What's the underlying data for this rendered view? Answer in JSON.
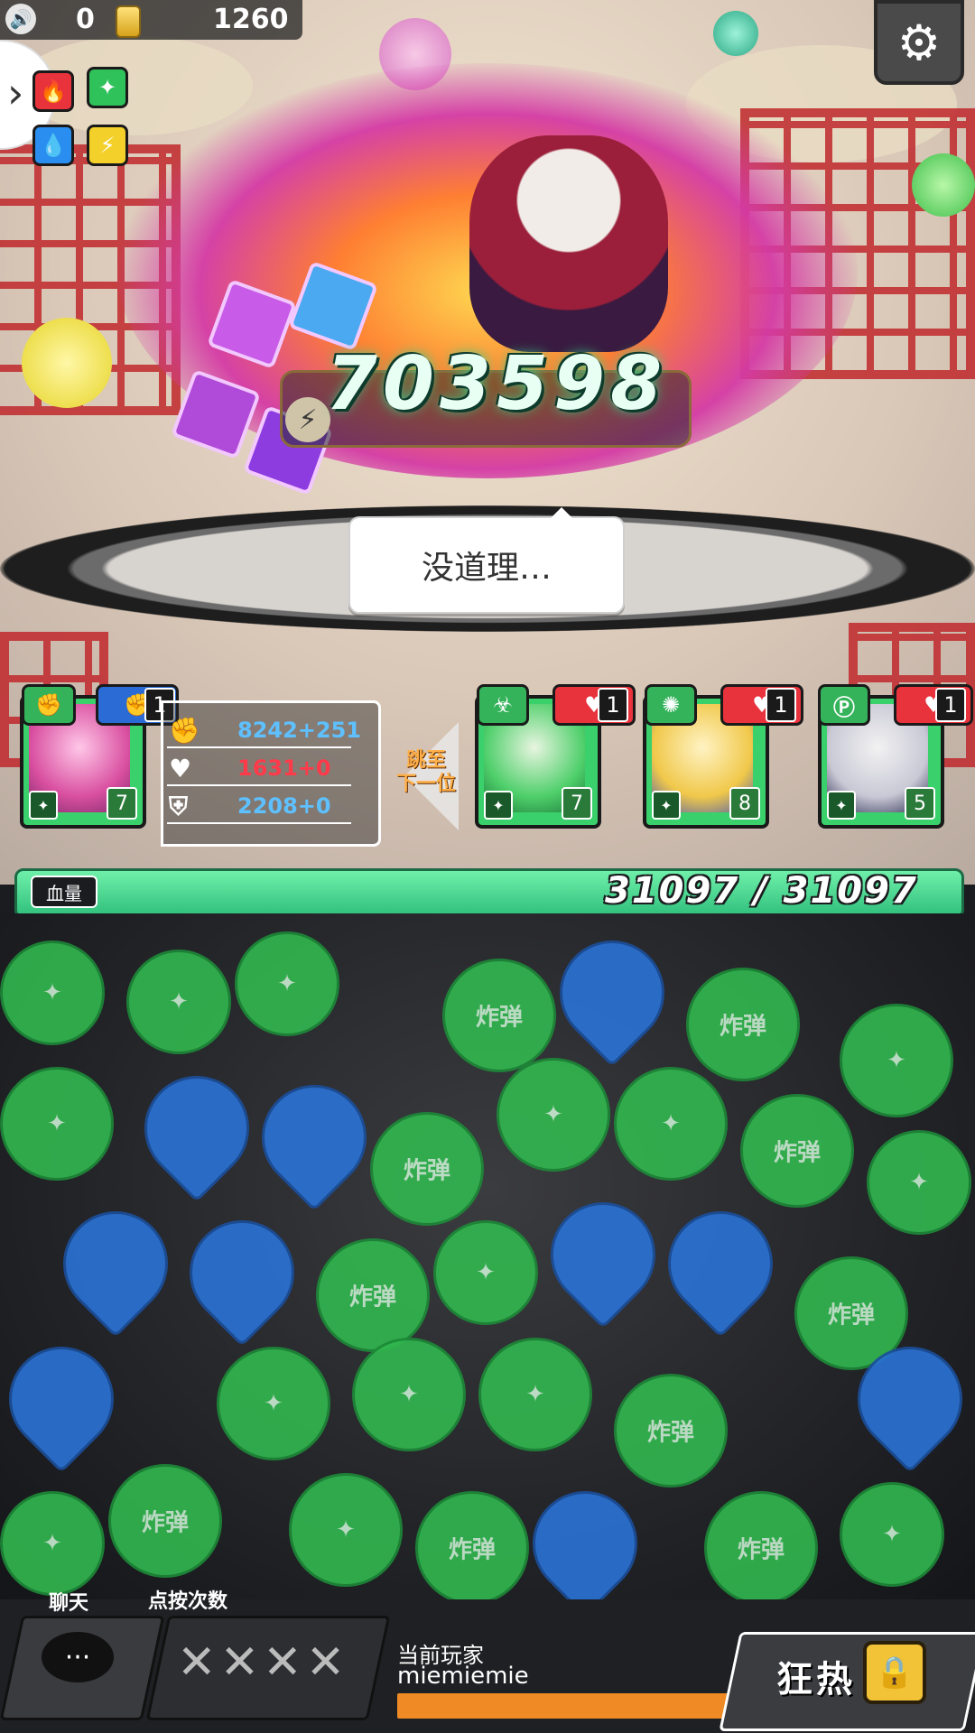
{
  "hud": {
    "coins": "0",
    "gold": "1260",
    "sound_icon": "speaker-icon",
    "settings_icon": "gear-icon",
    "elements": [
      "fire-icon",
      "wood-icon",
      "water-icon",
      "thunder-icon"
    ]
  },
  "battle": {
    "damage": "703598",
    "boss_line": "没道理…"
  },
  "team": {
    "leader": {
      "stats": {
        "attack": "8242+251",
        "hp": "1631+0",
        "defense": "2208+0"
      },
      "level": "7",
      "badge_count": "1"
    },
    "skip_label_line1": "跳至",
    "skip_label_line2": "下一位",
    "others": [
      {
        "level": "7",
        "badge_count": "1"
      },
      {
        "level": "8",
        "badge_count": "1"
      },
      {
        "level": "5",
        "badge_count": "1"
      }
    ]
  },
  "hp": {
    "label": "血量",
    "value": "31097 / 31097"
  },
  "pit": {
    "bomb_text": "炸弹"
  },
  "bottom": {
    "chat_label": "聊天",
    "taps_label": "点按次数",
    "taps_value": "✕✕✕✕",
    "player_label": "当前玩家",
    "player_name": "miemiemie",
    "frenzy_label": "狂热"
  },
  "colors": {
    "accent_green": "#31b84f",
    "accent_blue": "#2a73d6",
    "progress_orange": "#f08a24",
    "lattice_red": "#c0282c"
  }
}
